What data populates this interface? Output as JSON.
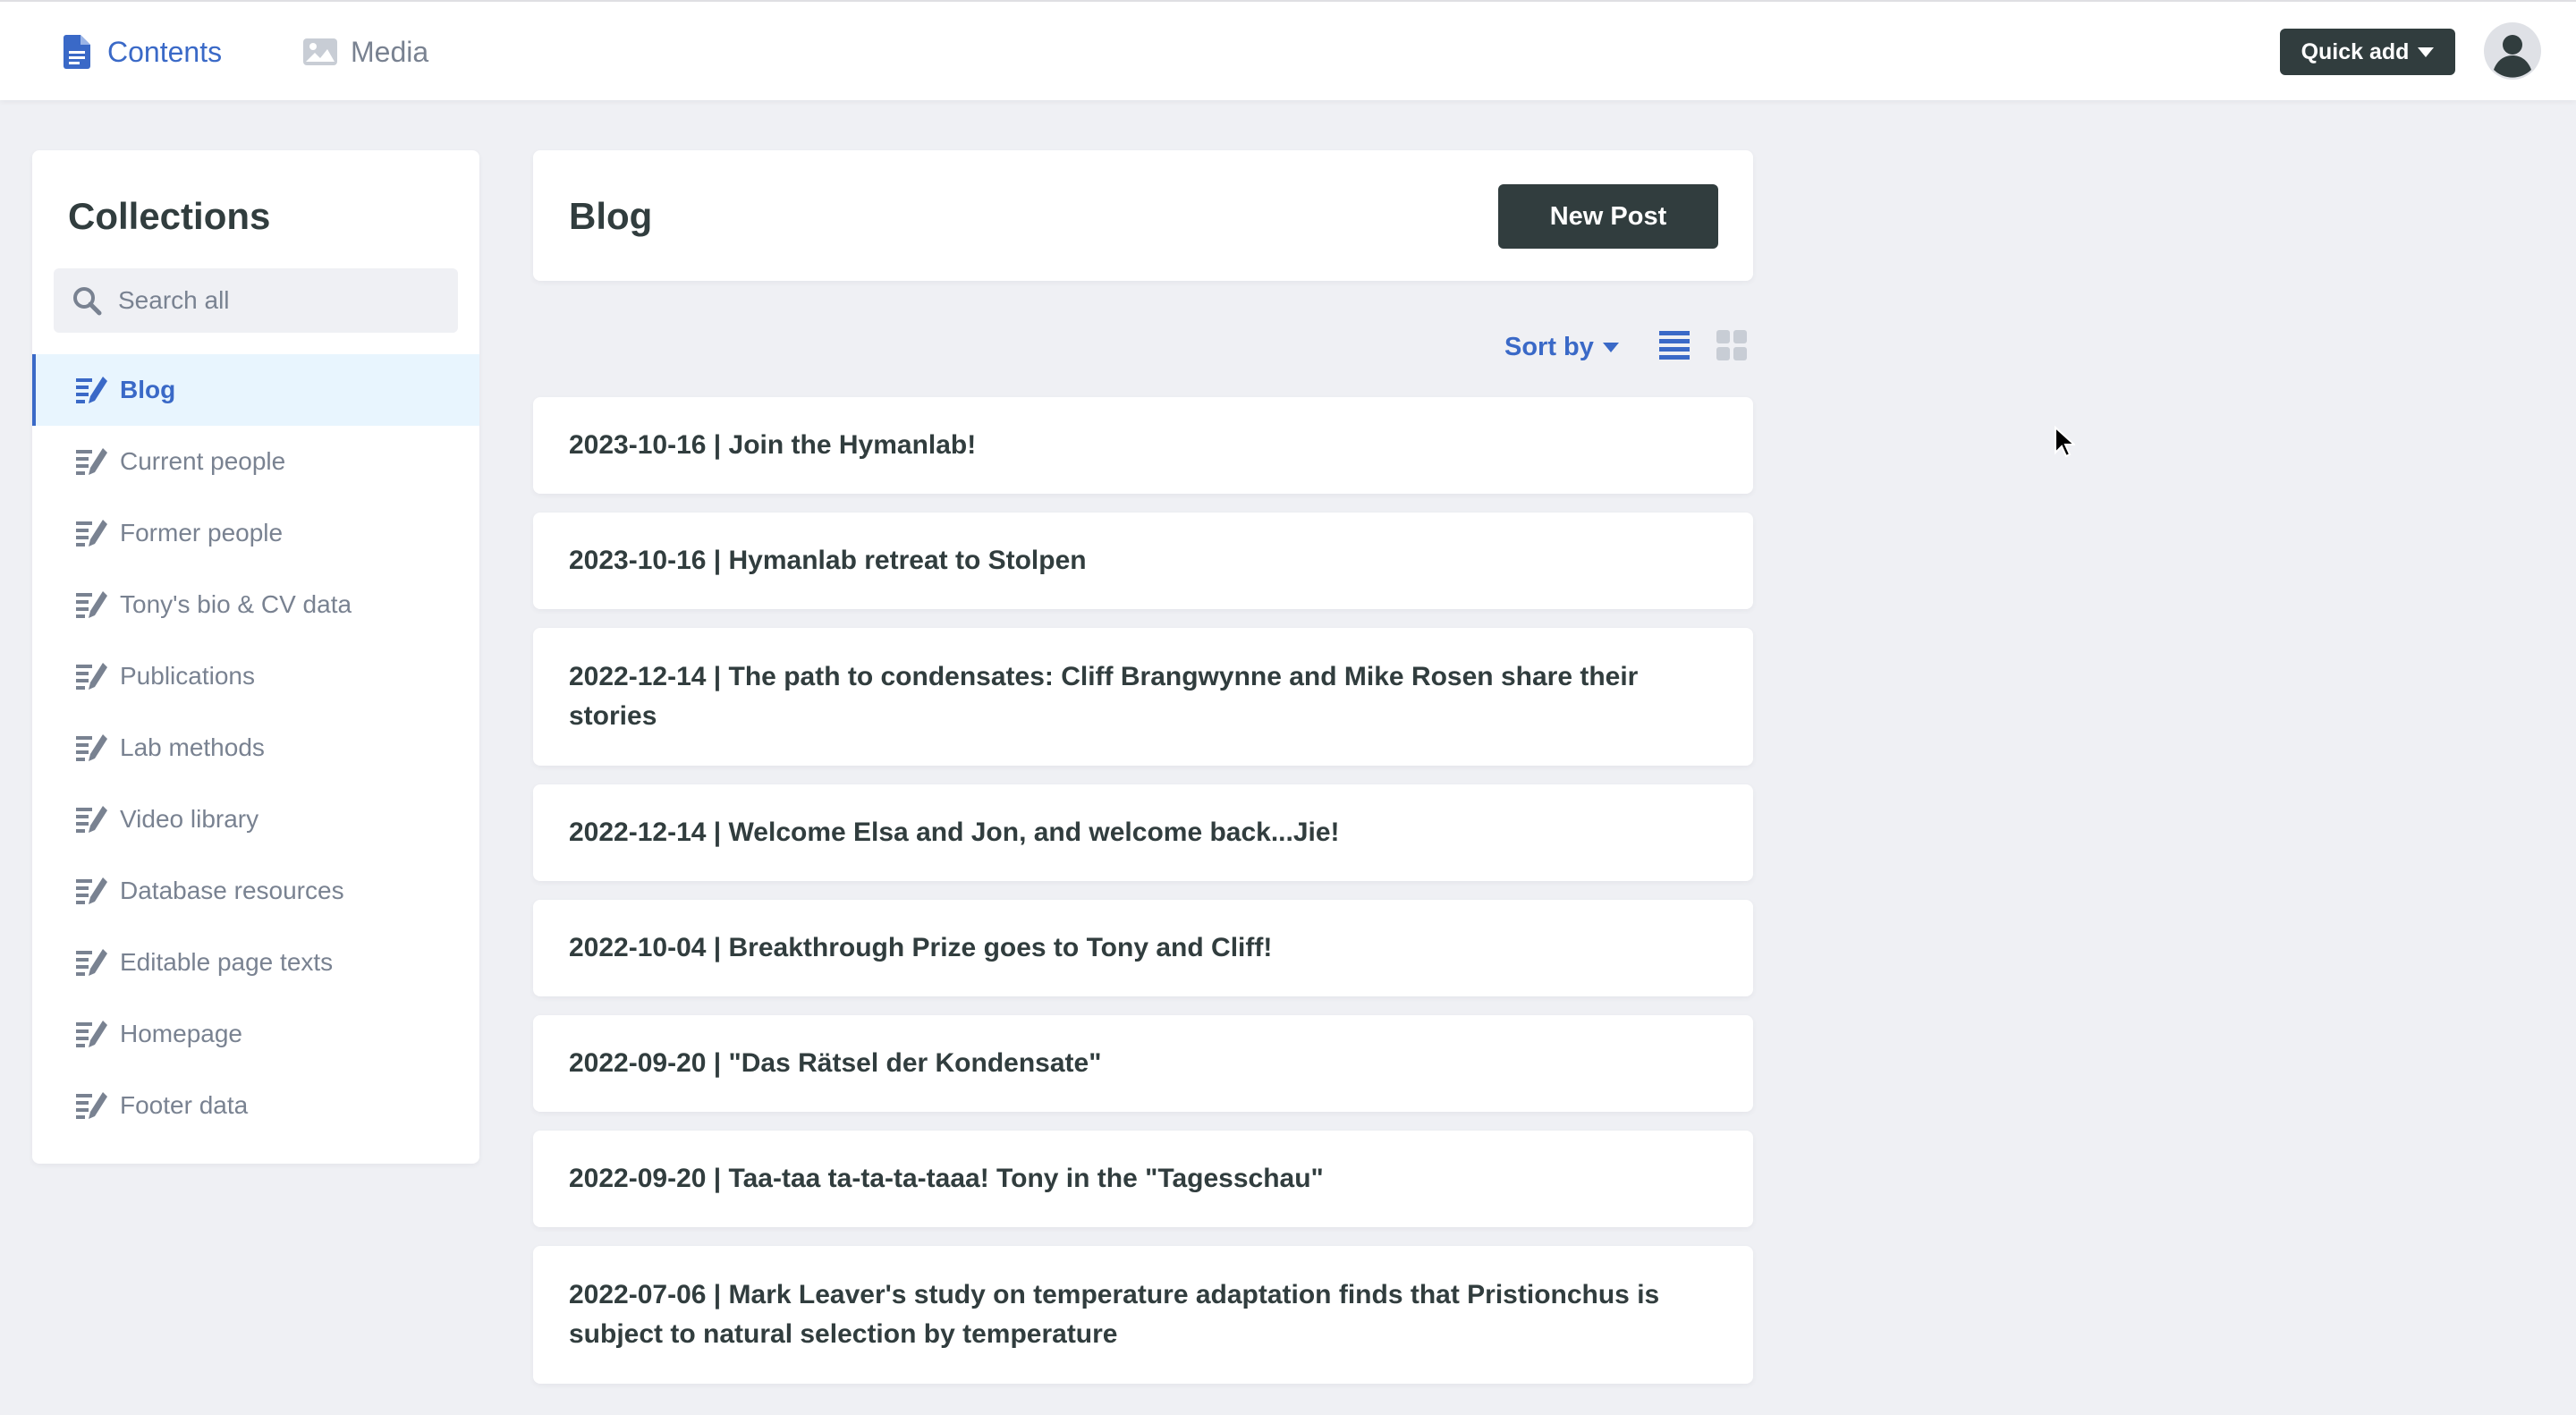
{
  "topbar": {
    "tabs": [
      {
        "label": "Contents",
        "icon": "document-icon",
        "active": true
      },
      {
        "label": "Media",
        "icon": "image-icon",
        "active": false
      }
    ],
    "quick_add_label": "Quick add",
    "avatar_icon": "user-avatar-icon"
  },
  "sidebar": {
    "title": "Collections",
    "search_placeholder": "Search all",
    "items": [
      {
        "label": "Blog",
        "active": true
      },
      {
        "label": "Current people"
      },
      {
        "label": "Former people"
      },
      {
        "label": "Tony's bio & CV data"
      },
      {
        "label": "Publications"
      },
      {
        "label": "Lab methods"
      },
      {
        "label": "Video library"
      },
      {
        "label": "Database resources"
      },
      {
        "label": "Editable page texts"
      },
      {
        "label": "Homepage"
      },
      {
        "label": "Footer data"
      }
    ]
  },
  "main": {
    "title": "Blog",
    "new_button": "New Post",
    "sort_label": "Sort by",
    "view_modes": [
      "list-view-icon",
      "grid-view-icon"
    ],
    "entries": [
      "2023-10-16 | Join the Hymanlab!",
      "2023-10-16 | Hymanlab retreat to Stolpen",
      "2022-12-14 | The path to condensates: Cliff Brangwynne and Mike Rosen share their stories",
      "2022-12-14 | Welcome Elsa and Jon, and welcome back...Jie!",
      "2022-10-04 | Breakthrough Prize goes to Tony and Cliff!",
      "2022-09-20 | \"Das Rätsel der Kondensate\"",
      "2022-09-20 | Taa-taa ta-ta-ta-taaa! Tony in the \"Tagesschau\"",
      "2022-07-06 | Mark Leaver's study on temperature adaptation finds that Pristionchus is subject to natural selection by temperature"
    ]
  },
  "colors": {
    "accent": "#3a69c7",
    "dark_button": "#313d3e",
    "background": "#eff0f4",
    "muted_text": "#798291"
  }
}
